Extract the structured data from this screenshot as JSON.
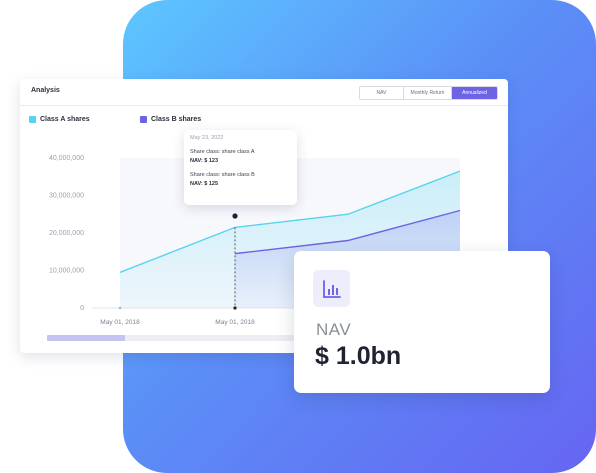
{
  "colors": {
    "brand": "#6c63e6",
    "series_a": "#57d3ef",
    "series_b": "#6c63e6"
  },
  "analysis": {
    "title": "Analysis",
    "tabs": [
      {
        "label": "NAV",
        "active": false
      },
      {
        "label": "Monthly Return",
        "active": false
      },
      {
        "label": "Annualized",
        "active": true
      }
    ],
    "legend": [
      {
        "label": "Class A shares",
        "color": "#57d3ef"
      },
      {
        "label": "Class B shares",
        "color": "#6c63e6"
      }
    ],
    "tooltip": {
      "date": "May 23, 2022",
      "entries": [
        {
          "label": "Share class: share class A",
          "value": "NAV: $ 123"
        },
        {
          "label": "Share class: share class B",
          "value": "NAV: $ 125"
        }
      ]
    }
  },
  "chart_data": {
    "type": "area",
    "y_ticks": [
      "40,000,000",
      "30,000,000",
      "20,000,000",
      "10,000,000",
      "0"
    ],
    "x_ticks": [
      "May 01, 2018",
      "May 01, 2018"
    ],
    "ylim": [
      0,
      40000000
    ],
    "grid": false,
    "legend_position": "top-left",
    "series": [
      {
        "name": "Class A shares",
        "color": "#57d3ef",
        "values": [
          9500000,
          21500000,
          25000000,
          36500000
        ]
      },
      {
        "name": "Class B shares",
        "color": "#6c63e6",
        "values": [
          null,
          14500000,
          18000000,
          26000000
        ]
      }
    ],
    "highlight_index": 1
  },
  "nav_card": {
    "icon": "bar-chart-icon",
    "label": "NAV",
    "value": "$ 1.0bn"
  }
}
